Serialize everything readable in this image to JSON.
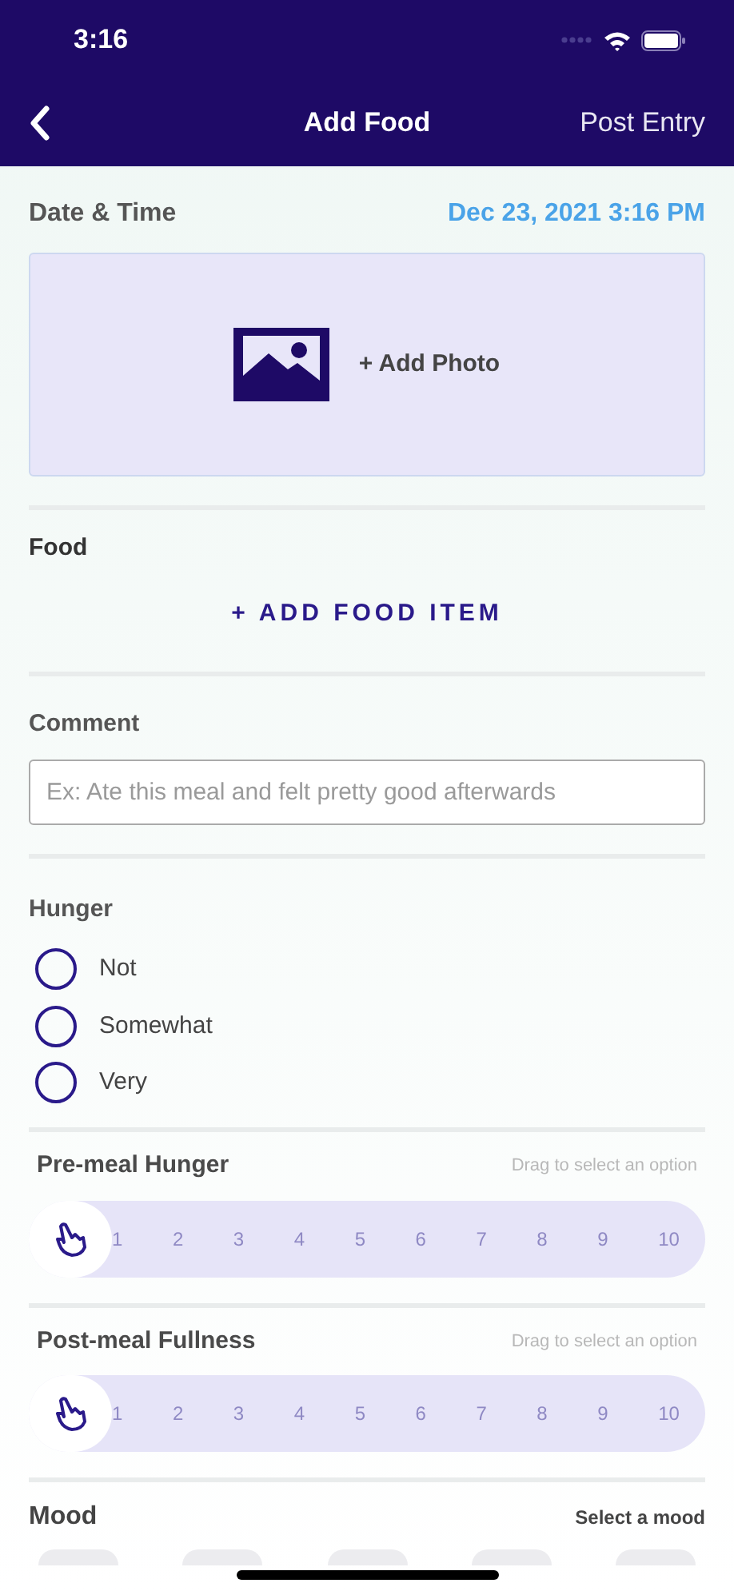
{
  "status_bar": {
    "time": "3:16"
  },
  "nav": {
    "title": "Add Food",
    "action": "Post Entry"
  },
  "date_time": {
    "label": "Date & Time",
    "value": "Dec 23, 2021 3:16 PM"
  },
  "photo": {
    "label": "+ Add Photo"
  },
  "food": {
    "label": "Food",
    "button": "+ ADD FOOD ITEM"
  },
  "comment": {
    "label": "Comment",
    "placeholder": "Ex: Ate this meal and felt pretty good afterwards"
  },
  "hunger": {
    "label": "Hunger",
    "options": [
      {
        "label": "Not",
        "selected": false
      },
      {
        "label": "Somewhat",
        "selected": false
      },
      {
        "label": "Very",
        "selected": false
      }
    ]
  },
  "scales": [
    {
      "label": "Pre-meal Hunger",
      "hint": "Drag to select an option",
      "level": 0,
      "ticks": [
        "1",
        "2",
        "3",
        "4",
        "5",
        "6",
        "7",
        "8",
        "9",
        "10"
      ]
    },
    {
      "label": "Post-meal Fullness",
      "hint": "Drag to select an option",
      "level": 0,
      "ticks": [
        "1",
        "2",
        "3",
        "4",
        "5",
        "6",
        "7",
        "8",
        "9",
        "10"
      ]
    }
  ],
  "mood": {
    "label": "Mood",
    "hint": "Select a mood"
  }
}
